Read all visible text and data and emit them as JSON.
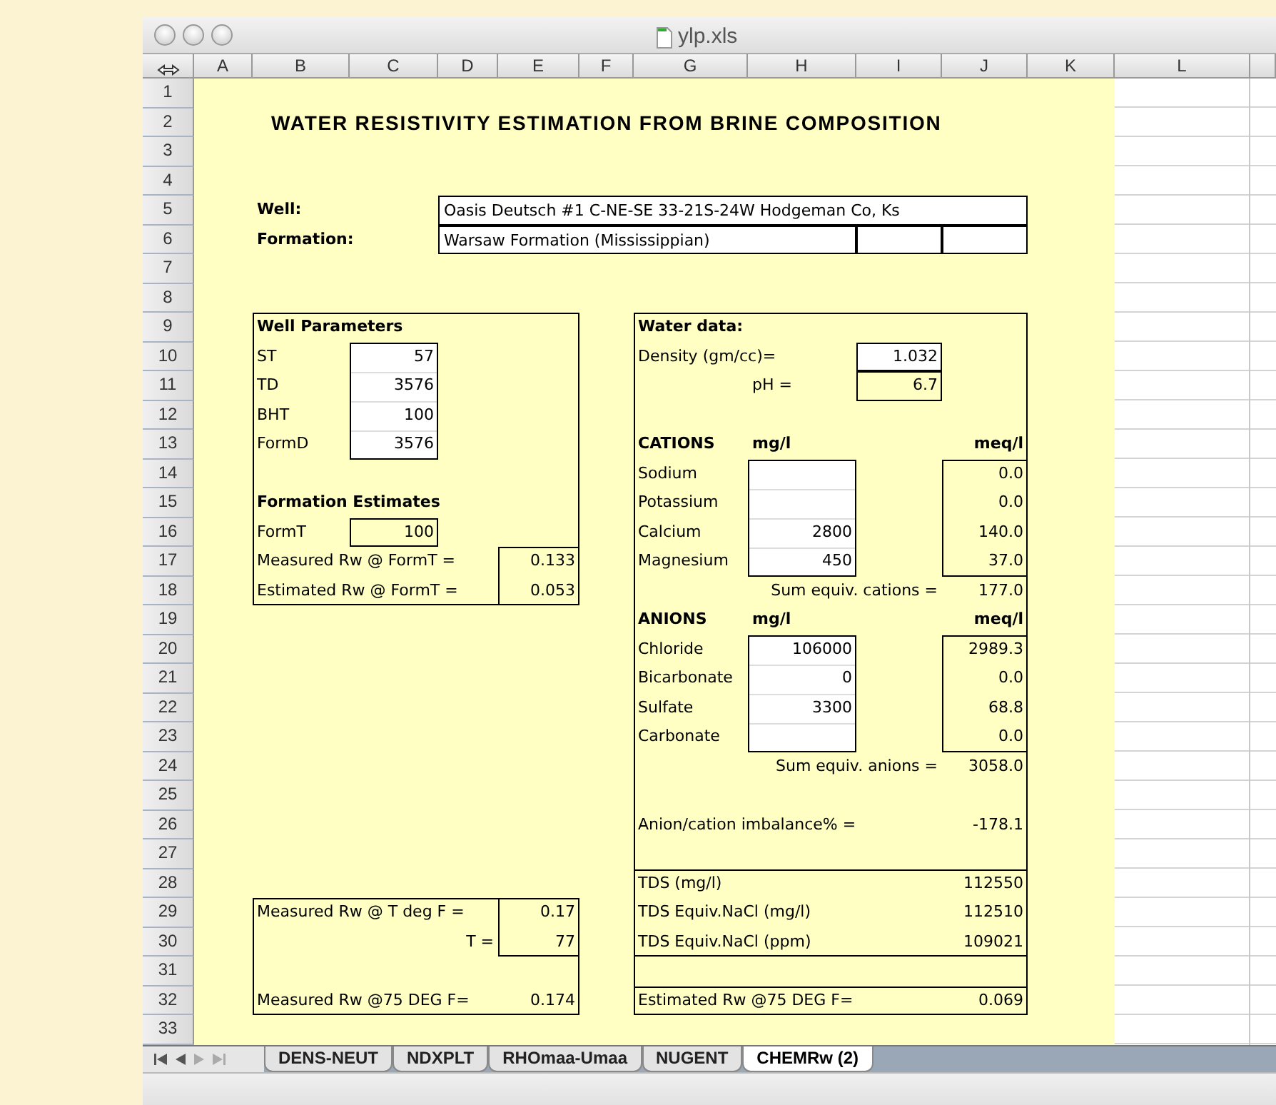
{
  "window": {
    "title": "ylp.xls"
  },
  "column_headers": [
    "A",
    "B",
    "C",
    "D",
    "E",
    "F",
    "G",
    "H",
    "I",
    "J",
    "K",
    "L"
  ],
  "row_headers": [
    "1",
    "2",
    "3",
    "4",
    "5",
    "6",
    "7",
    "8",
    "9",
    "10",
    "11",
    "12",
    "13",
    "14",
    "15",
    "16",
    "17",
    "18",
    "19",
    "20",
    "21",
    "22",
    "23",
    "24",
    "25",
    "26",
    "27",
    "28",
    "29",
    "30",
    "31",
    "32",
    "33"
  ],
  "cells": [
    {
      "kind": "title",
      "text": "WATER RESISTIVITY ESTIMATION FROM BRINE COMPOSITION"
    },
    {
      "kind": "heading",
      "text": "Well:"
    },
    {
      "kind": "field",
      "text": "Oasis Deutsch #1  C-NE-SE 33-21S-24W  Hodgeman Co, Ks"
    },
    {
      "kind": "heading",
      "text": "Formation:"
    },
    {
      "kind": "field",
      "text": "Warsaw Formation (Mississippian)"
    },
    {
      "kind": "heading",
      "text": "Well Parameters"
    },
    {
      "kind": "label",
      "text": "ST"
    },
    {
      "kind": "number",
      "text": "57"
    },
    {
      "kind": "label",
      "text": "TD"
    },
    {
      "kind": "number",
      "text": "3576"
    },
    {
      "kind": "label",
      "text": "BHT"
    },
    {
      "kind": "number",
      "text": "100"
    },
    {
      "kind": "label",
      "text": "FormD"
    },
    {
      "kind": "number",
      "text": "3576"
    },
    {
      "kind": "heading",
      "text": "Formation Estimates"
    },
    {
      "kind": "label",
      "text": "FormT"
    },
    {
      "kind": "number",
      "text": "100"
    },
    {
      "kind": "label",
      "text": "Measured Rw @ FormT ="
    },
    {
      "kind": "number",
      "text": "0.133"
    },
    {
      "kind": "label",
      "text": "Estimated Rw @ FormT ="
    },
    {
      "kind": "number",
      "text": "0.053"
    },
    {
      "kind": "heading",
      "text": "Water data:"
    },
    {
      "kind": "label",
      "text": "Density (gm/cc)="
    },
    {
      "kind": "number",
      "text": "1.032"
    },
    {
      "kind": "label",
      "text": "pH ="
    },
    {
      "kind": "number",
      "text": "6.7"
    },
    {
      "kind": "heading",
      "text": "CATIONS"
    },
    {
      "kind": "heading",
      "text": "mg/l"
    },
    {
      "kind": "heading-right",
      "text": "meq/l"
    },
    {
      "kind": "label",
      "text": "Sodium"
    },
    {
      "kind": "number",
      "text": "0.0"
    },
    {
      "kind": "label",
      "text": "Potassium"
    },
    {
      "kind": "number",
      "text": "0.0"
    },
    {
      "kind": "label",
      "text": "Calcium"
    },
    {
      "kind": "number",
      "text": "2800"
    },
    {
      "kind": "number",
      "text": "140.0"
    },
    {
      "kind": "label",
      "text": "Magnesium"
    },
    {
      "kind": "number",
      "text": "450"
    },
    {
      "kind": "number",
      "text": "37.0"
    },
    {
      "kind": "label-right",
      "text": "Sum equiv. cations ="
    },
    {
      "kind": "number",
      "text": "177.0"
    },
    {
      "kind": "heading",
      "text": "ANIONS"
    },
    {
      "kind": "heading",
      "text": "mg/l"
    },
    {
      "kind": "heading-right",
      "text": "meq/l"
    },
    {
      "kind": "label",
      "text": "Chloride"
    },
    {
      "kind": "number",
      "text": "106000"
    },
    {
      "kind": "number",
      "text": "2989.3"
    },
    {
      "kind": "label",
      "text": "Bicarbonate"
    },
    {
      "kind": "number",
      "text": "0"
    },
    {
      "kind": "number",
      "text": "0.0"
    },
    {
      "kind": "label",
      "text": "Sulfate"
    },
    {
      "kind": "number",
      "text": "3300"
    },
    {
      "kind": "number",
      "text": "68.8"
    },
    {
      "kind": "label",
      "text": "Carbonate"
    },
    {
      "kind": "number",
      "text": "0.0"
    },
    {
      "kind": "label-right",
      "text": "Sum equiv. anions ="
    },
    {
      "kind": "number",
      "text": "3058.0"
    },
    {
      "kind": "label",
      "text": "Anion/cation imbalance% ="
    },
    {
      "kind": "number",
      "text": "-178.1"
    },
    {
      "kind": "label",
      "text": "TDS (mg/l)"
    },
    {
      "kind": "number",
      "text": "112550"
    },
    {
      "kind": "label",
      "text": "TDS Equiv.NaCl (mg/l)"
    },
    {
      "kind": "number",
      "text": "112510"
    },
    {
      "kind": "label",
      "text": "TDS Equiv.NaCl (ppm)"
    },
    {
      "kind": "number",
      "text": "109021"
    },
    {
      "kind": "label",
      "text": "Estimated Rw @75 DEG F="
    },
    {
      "kind": "number",
      "text": "0.069"
    },
    {
      "kind": "label",
      "text": "Measured Rw @ T deg F ="
    },
    {
      "kind": "number",
      "text": "0.17"
    },
    {
      "kind": "label-right",
      "text": "T ="
    },
    {
      "kind": "number",
      "text": "77"
    },
    {
      "kind": "label",
      "text": "Measured Rw @75 DEG F="
    },
    {
      "kind": "number",
      "text": "0.174"
    }
  ],
  "sheet_tabs": [
    {
      "label": "DENS-NEUT",
      "selected": false
    },
    {
      "label": "NDXPLT",
      "selected": false
    },
    {
      "label": "RHOmaa-Umaa",
      "selected": false
    },
    {
      "label": "NUGENT",
      "selected": false
    },
    {
      "label": "CHEMRw (2)",
      "selected": true
    }
  ]
}
